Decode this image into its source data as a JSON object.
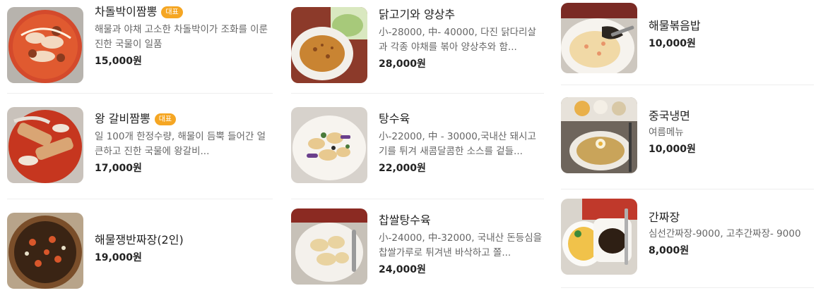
{
  "colors": {
    "badge": "#f5a623",
    "text": "#222222",
    "desc": "#666666",
    "divider": "#eeeeee"
  },
  "columns": [
    {
      "items": [
        {
          "name": "차돌박이짬뽕",
          "badge": "대표",
          "desc": "해물과 야채 고소한 차돌박이가 조화를 이룬 진한 국물이 일품",
          "price": "15,000원",
          "image": "jjamppong-bowl"
        },
        {
          "name": "왕 갈비짬뽕",
          "badge": "대표",
          "desc": "일 100개 한정수량, 해물이 듬뿍 들어간 얼큰하고 진한 국물에 왕갈비...",
          "price": "17,000원",
          "image": "galbi-jjamppong-bowl"
        },
        {
          "name": "해물쟁반짜장(2인)",
          "badge": "",
          "desc": "",
          "price": "19,000원",
          "image": "jajang-pan"
        }
      ]
    },
    {
      "items": [
        {
          "name": "닭고기와 양상추",
          "badge": "",
          "desc": "小-28000, 中- 40000, 다진 닭다리살과 각종 야채를 볶아 양상추와 함...",
          "price": "28,000원",
          "image": "chicken-lettuce-plate"
        },
        {
          "name": "탕수육",
          "badge": "",
          "desc": "小-22000, 中 - 30000,국내산 돼시고기를 튀겨 새콤달콤한 소스를 겉들...",
          "price": "22,000원",
          "image": "tangsuyuk-plate"
        },
        {
          "name": "찹쌀탕수육",
          "badge": "",
          "desc": "小-24000, 中-32000, 국내산 돈등심을 찹쌀가루로 튀겨낸 바삭하고 쫄...",
          "price": "24,000원",
          "image": "glutinous-tangsuyuk-plate"
        }
      ]
    },
    {
      "items": [
        {
          "name": "해물볶음밥",
          "badge": "",
          "desc": "",
          "price": "10,000원",
          "image": "fried-rice-plate"
        },
        {
          "name": "중국냉면",
          "badge": "",
          "desc": "여름메뉴",
          "price": "10,000원",
          "image": "cold-noodle-table"
        },
        {
          "name": "간짜장",
          "badge": "",
          "desc": "심선간짜장-9000, 고추간짜장- 9000",
          "price": "8,000원",
          "image": "ganjajang-plate"
        }
      ]
    }
  ]
}
